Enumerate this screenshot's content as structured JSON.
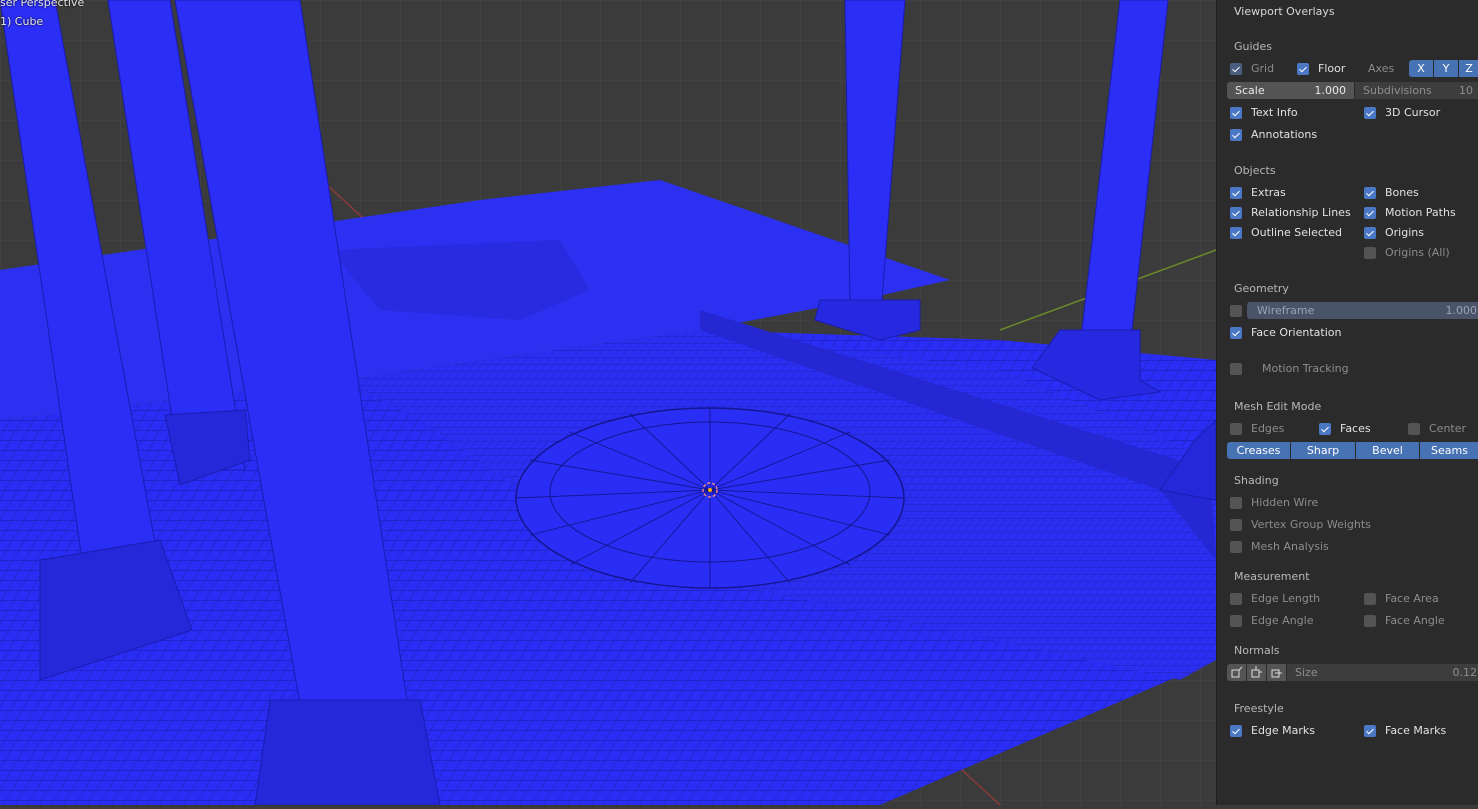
{
  "viewport": {
    "view_label": "ser Perspective",
    "object_label": "1) Cube"
  },
  "overlays": {
    "title": "Viewport Overlays",
    "guides": {
      "heading": "Guides",
      "grid": "Grid",
      "floor": "Floor",
      "axes": "Axes",
      "axis_x": "X",
      "axis_y": "Y",
      "axis_z": "Z",
      "scale_label": "Scale",
      "scale_value": "1.000",
      "subdivisions_label": "Subdivisions",
      "subdivisions_value": "10",
      "text_info": "Text Info",
      "cursor_3d": "3D Cursor",
      "annotations": "Annotations"
    },
    "objects": {
      "heading": "Objects",
      "extras": "Extras",
      "bones": "Bones",
      "relationship_lines": "Relationship Lines",
      "motion_paths": "Motion Paths",
      "outline_selected": "Outline Selected",
      "origins": "Origins",
      "origins_all": "Origins (All)"
    },
    "geometry": {
      "heading": "Geometry",
      "wireframe_label": "Wireframe",
      "wireframe_value": "1.000",
      "face_orientation": "Face Orientation",
      "motion_tracking": "Motion Tracking"
    },
    "mesh_edit": {
      "heading": "Mesh Edit Mode",
      "edges": "Edges",
      "faces": "Faces",
      "center": "Center",
      "creases": "Creases",
      "sharp": "Sharp",
      "bevel": "Bevel",
      "seams": "Seams"
    },
    "shading": {
      "heading": "Shading",
      "hidden_wire": "Hidden Wire",
      "vertex_group_weights": "Vertex Group Weights",
      "mesh_analysis": "Mesh Analysis"
    },
    "measurement": {
      "heading": "Measurement",
      "edge_length": "Edge Length",
      "face_area": "Face Area",
      "edge_angle": "Edge Angle",
      "face_angle": "Face Angle"
    },
    "normals": {
      "heading": "Normals",
      "size_label": "Size",
      "size_value": "0.12"
    },
    "freestyle": {
      "heading": "Freestyle",
      "edge_marks": "Edge Marks",
      "face_marks": "Face Marks"
    }
  },
  "colors": {
    "checkbox_on": "#4b78c4",
    "button_active": "#4772b3",
    "mesh_face": "#2a2ef5",
    "panel_bg": "#2b2b2b"
  }
}
